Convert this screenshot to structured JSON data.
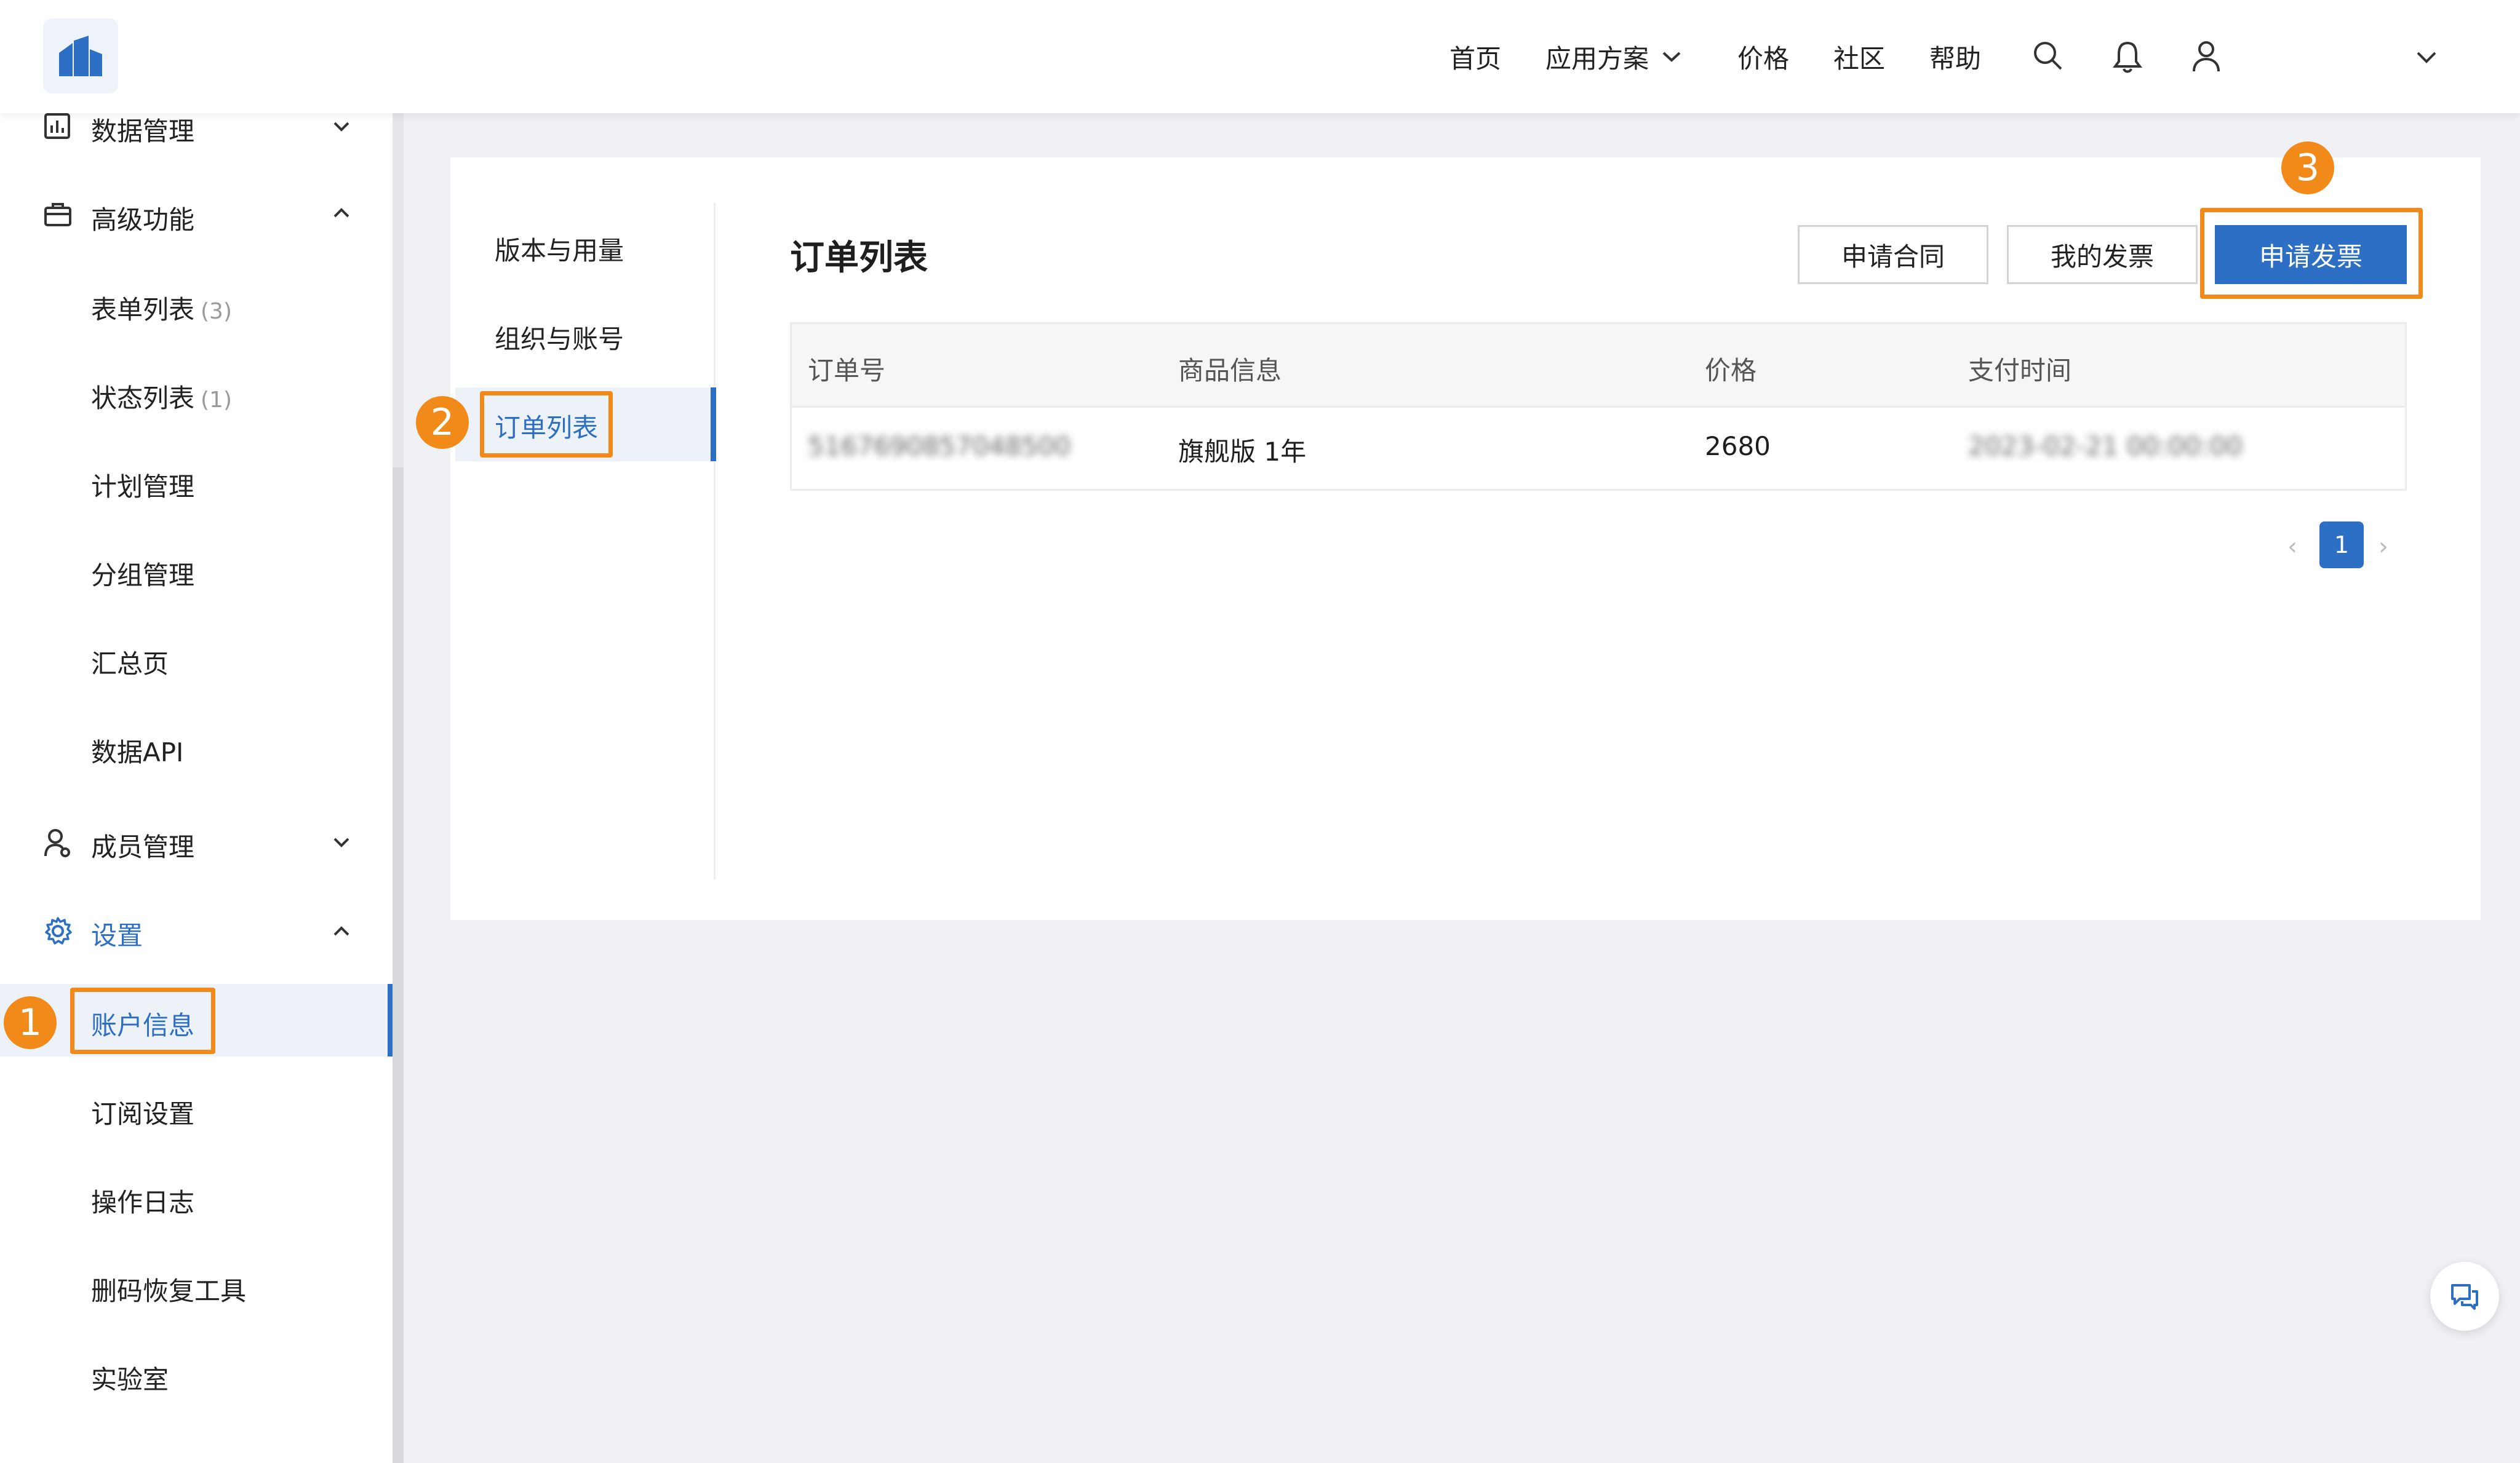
{
  "topbar": {
    "nav": [
      "首页",
      "应用方案",
      "价格",
      "社区",
      "帮助"
    ],
    "icons": [
      "search-icon",
      "bell-icon",
      "user-icon",
      "chevron-down-icon"
    ]
  },
  "sidebar": {
    "data_management": "数据管理",
    "advanced": "高级功能",
    "form_list": "表单列表",
    "form_list_count": "(3)",
    "status_list": "状态列表",
    "status_list_count": "(1)",
    "plan_mgmt": "计划管理",
    "group_mgmt": "分组管理",
    "summary": "汇总页",
    "data_api": "数据API",
    "members": "成员管理",
    "settings": "设置",
    "account_info": "账户信息",
    "subscription": "订阅设置",
    "op_log": "操作日志",
    "recovery": "删码恢复工具",
    "lab": "实验室"
  },
  "subnav": {
    "items": [
      "版本与用量",
      "组织与账号",
      "订单列表"
    ],
    "active": "订单列表"
  },
  "main": {
    "title": "订单列表",
    "buttons": {
      "contract": "申请合同",
      "my_invoice": "我的发票",
      "apply_invoice": "申请发票"
    },
    "table": {
      "headers": [
        "订单号",
        "商品信息",
        "价格",
        "支付时间"
      ],
      "rows": [
        {
          "order_no": "5167690857048500",
          "product": "旗舰版 1年",
          "price": "2680",
          "paid_at": "2023-02-21 00:00:00"
        }
      ]
    },
    "pagination": {
      "current": "1",
      "prev": "‹",
      "next": "›"
    }
  },
  "callouts": [
    "1",
    "2",
    "3"
  ],
  "colors": {
    "accent": "#2c6fc4",
    "highlight": "#f28a1a",
    "page_bg": "#f0f1f4"
  }
}
